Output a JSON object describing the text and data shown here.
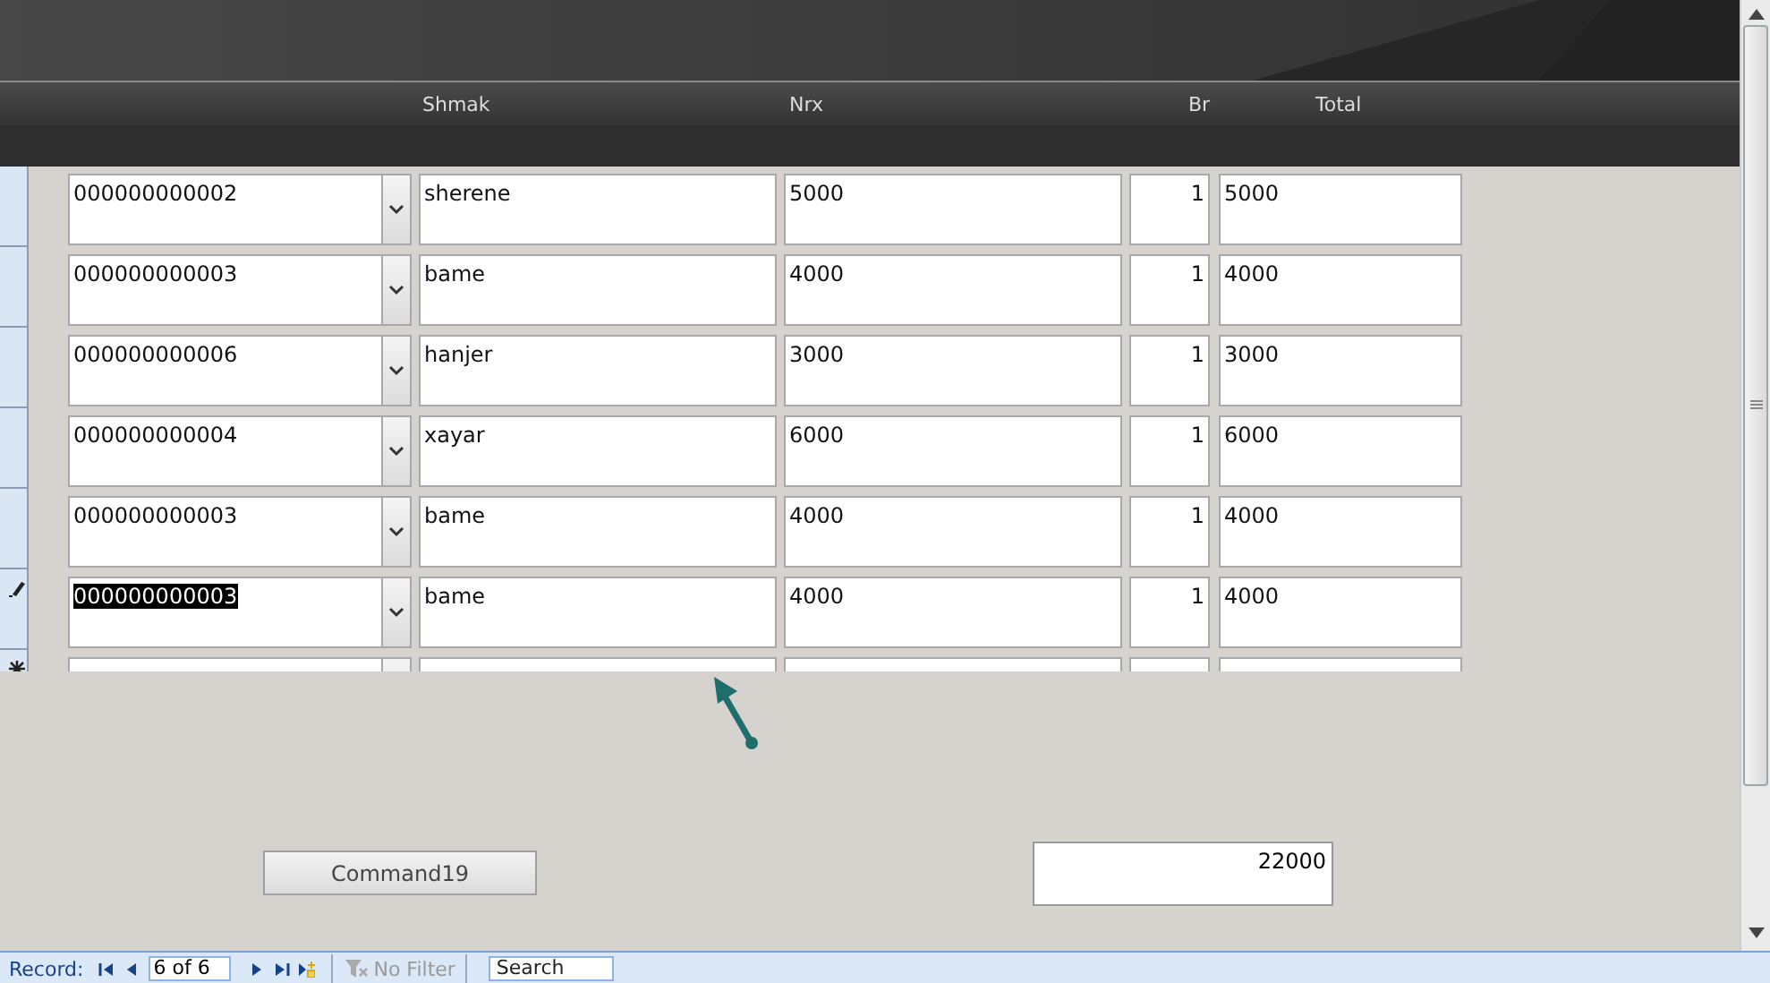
{
  "columns": [
    "Shmak",
    "Nrx",
    "Br",
    "Total"
  ],
  "rows": [
    {
      "kind": "record",
      "editing": false,
      "code": "000000000002",
      "code_selected": false,
      "shmak": "sherene",
      "nrx": "5000",
      "br": "1",
      "total": "5000"
    },
    {
      "kind": "record",
      "editing": false,
      "code": "000000000003",
      "code_selected": false,
      "shmak": "bame",
      "nrx": "4000",
      "br": "1",
      "total": "4000"
    },
    {
      "kind": "record",
      "editing": false,
      "code": "000000000006",
      "code_selected": false,
      "shmak": "hanjer",
      "nrx": "3000",
      "br": "1",
      "total": "3000"
    },
    {
      "kind": "record",
      "editing": false,
      "code": "000000000004",
      "code_selected": false,
      "shmak": "xayar",
      "nrx": "6000",
      "br": "1",
      "total": "6000"
    },
    {
      "kind": "record",
      "editing": false,
      "code": "000000000003",
      "code_selected": false,
      "shmak": "bame",
      "nrx": "4000",
      "br": "1",
      "total": "4000"
    },
    {
      "kind": "record",
      "editing": true,
      "code": "000000000003",
      "code_selected": true,
      "shmak": "bame",
      "nrx": "4000",
      "br": "1",
      "total": "4000"
    },
    {
      "kind": "new"
    }
  ],
  "command_button": "Command19",
  "grand_total": "22000",
  "navigation": {
    "label": "Record:",
    "position": "6 of 6",
    "filter": "No Filter",
    "filter_disabled": true,
    "search": "Search"
  }
}
